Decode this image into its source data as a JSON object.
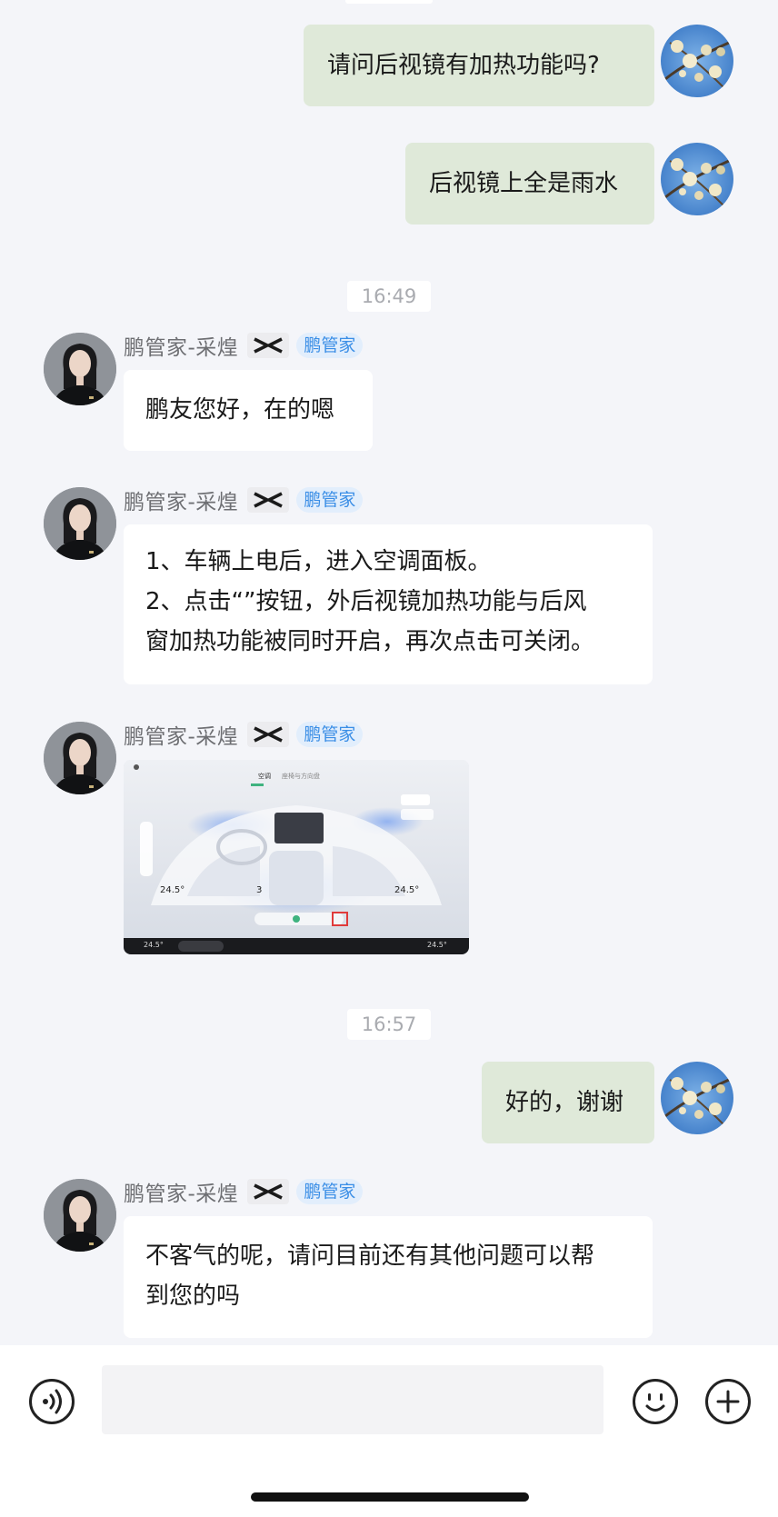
{
  "messages": [
    {
      "type": "out",
      "text": "请问后视镜有加热功能吗?"
    },
    {
      "type": "out",
      "text": "后视镜上全是雨水"
    },
    {
      "type": "time",
      "text": "16:49"
    },
    {
      "type": "in",
      "sender": "鹏管家-采煌",
      "badge": "鹏管家",
      "lines": [
        "鹏友您好，在的嗯"
      ]
    },
    {
      "type": "in",
      "sender": "鹏管家-采煌",
      "badge": "鹏管家",
      "lines": [
        "1、车辆上电后，进入空调面板。",
        "2、点击“”按钮，外后视镜加热功能与后风",
        "窗加热功能被同时开启，再次点击可关闭。"
      ]
    },
    {
      "type": "in-image",
      "sender": "鹏管家-采煌",
      "badge": "鹏管家"
    },
    {
      "type": "time",
      "text": "16:57"
    },
    {
      "type": "out",
      "text": "好的，谢谢"
    },
    {
      "type": "in",
      "sender": "鹏管家-采煌",
      "badge": "鹏管家",
      "lines": [
        "不客气的呢，请问目前还有其他问题可以帮",
        "到您的吗"
      ]
    }
  ],
  "screenshot": {
    "tabs": [
      "空调",
      "座椅与方向盘"
    ],
    "temp_left": "24.5°",
    "temp_right": "24.5°",
    "fan_level": "3",
    "dock_temp_left": "24.5°",
    "dock_temp_right": "24.5°"
  },
  "input": {
    "placeholder": ""
  },
  "icons": {
    "voice": "voice-icon",
    "emoji": "emoji-icon",
    "add": "plus-icon",
    "brand": "brand-logo-icon"
  },
  "colors": {
    "outgoing_bubble": "#dfe9d9",
    "incoming_bubble": "#ffffff",
    "badge_text": "#3a8ee6",
    "badge_bg": "#e2eefc",
    "background": "#f4f5f9"
  }
}
